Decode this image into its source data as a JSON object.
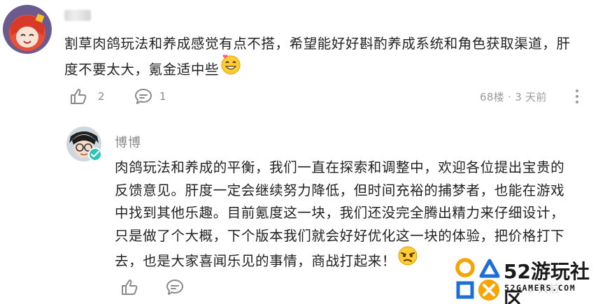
{
  "comment": {
    "text_line1": "割草肉鸽玩法和养成感觉有点不搭，希望能好好斟酌养成系统和角色获取渠道，肝",
    "text_line2": "度不要太大，氪金适中些",
    "emoji": "grin-heart-emoji",
    "likes": "2",
    "replies": "1",
    "floor_and_time": "68楼 · 3 天前"
  },
  "reply": {
    "author": "博博",
    "lines": [
      "肉鸽玩法和养成的平衡，我们一直在探索和调整中，欢迎各位提出宝贵的",
      "反馈意见。肝度一定会继续努力降低，但时间充裕的捕梦者，也能在游戏",
      "中找到其他乐趣。目前氪度这一块，我们还没完全腾出精力来仔细设计，",
      "只是做了个大概，下个版本我们就会好好优化这一块的体验，把价格打下",
      "去，也是大家喜闻乐见的事情，商战打起来！"
    ],
    "emoji": "smug-emoji",
    "time_partial": "3 天前"
  },
  "watermark": {
    "title": "52游玩社区",
    "subtitle": "52GAMERS.COM"
  },
  "colors": {
    "accent_verified": "#2ec4b6",
    "text": "#222222",
    "muted": "#8a8a8a",
    "logo_orange": "#f5a400",
    "logo_blue": "#1c6fd6"
  }
}
